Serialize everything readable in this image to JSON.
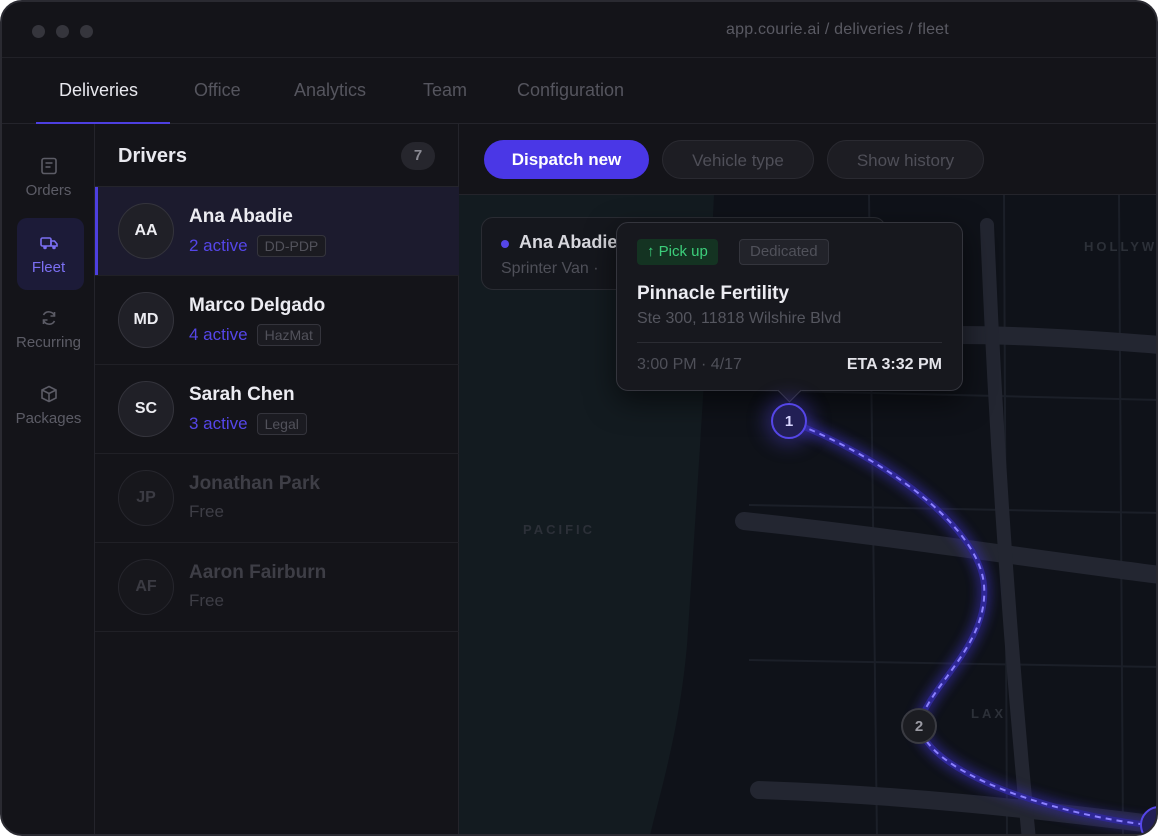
{
  "window": {
    "url": "app.courie.ai / deliveries / fleet"
  },
  "topnav": {
    "tabs": [
      {
        "label": "Deliveries",
        "active": true
      },
      {
        "label": "Office",
        "active": false
      },
      {
        "label": "Analytics",
        "active": false
      },
      {
        "label": "Team",
        "active": false
      },
      {
        "label": "Configuration",
        "active": false
      }
    ]
  },
  "rail": {
    "items": [
      {
        "label": "Orders",
        "icon": "orders-icon",
        "active": false
      },
      {
        "label": "Fleet",
        "icon": "truck-icon",
        "active": true
      },
      {
        "label": "Recurring",
        "icon": "refresh-icon",
        "active": false
      },
      {
        "label": "Packages",
        "icon": "package-icon",
        "active": false
      }
    ]
  },
  "drivers": {
    "title": "Drivers",
    "count": "7",
    "list": [
      {
        "initials": "AA",
        "name": "Ana Abadie",
        "active": "2 active",
        "tag": "DD-PDP",
        "selected": true
      },
      {
        "initials": "MD",
        "name": "Marco Delgado",
        "active": "4 active",
        "tag": "HazMat"
      },
      {
        "initials": "SC",
        "name": "Sarah Chen",
        "active": "3 active",
        "tag": "Legal"
      },
      {
        "initials": "JP",
        "name": "Jonathan Park",
        "status": "Free"
      },
      {
        "initials": "AF",
        "name": "Aaron Fairburn",
        "status": "Free"
      }
    ]
  },
  "toolbar": {
    "dispatch_label": "Dispatch new",
    "vehicle_label": "Vehicle type",
    "history_label": "Show history"
  },
  "map": {
    "labels": {
      "hollywood": "HOLLYW",
      "pacific": "PACIFIC",
      "lax": "LAX"
    },
    "vehicle_card": {
      "name": "Ana Abadie",
      "sub": "Sprinter Van ·"
    },
    "popup": {
      "pickup": "↑ Pick up",
      "dedicated": "Dedicated",
      "title": "Pinnacle Fertility",
      "address": "Ste 300, 11818 Wilshire Blvd",
      "time": "3:00 PM · 4/17",
      "eta": "ETA 3:32 PM"
    },
    "stops": [
      "1",
      "2"
    ]
  },
  "colors": {
    "accent": "#4a37e6",
    "pickup_green": "#3ccf7b",
    "background": "#141419"
  }
}
